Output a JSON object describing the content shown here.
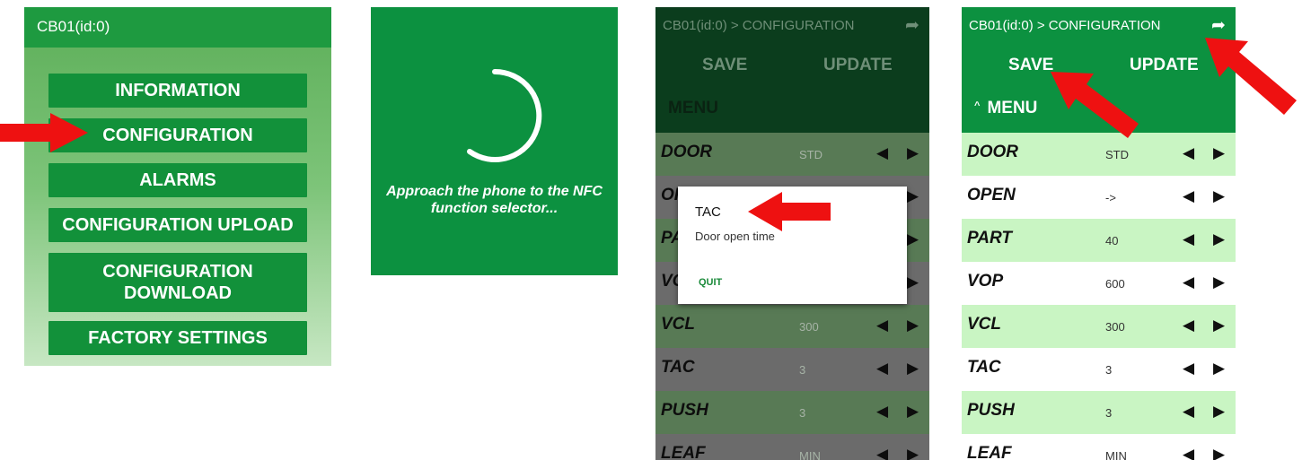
{
  "menu_screen": {
    "title": "CB01(id:0)",
    "buttons": [
      "INFORMATION",
      "CONFIGURATION",
      "ALARMS",
      "CONFIGURATION UPLOAD",
      "CONFIGURATION\nDOWNLOAD",
      "FACTORY SETTINGS"
    ]
  },
  "loading_screen": {
    "message": "Approach the phone to the NFC function selector..."
  },
  "config_screen": {
    "breadcrumb": "CB01(id:0) > CONFIGURATION",
    "share_icon": "share-icon",
    "save_label": "SAVE",
    "update_label": "UPDATE",
    "menu_label": "MENU",
    "left_arrow": "◀",
    "right_arrow": "▶",
    "rows": [
      {
        "name": "DOOR",
        "value": "STD"
      },
      {
        "name": "OPEN",
        "value": "->"
      },
      {
        "name": "PART",
        "value": "40"
      },
      {
        "name": "VOP",
        "value": "600"
      },
      {
        "name": "VCL",
        "value": "300"
      },
      {
        "name": "TAC",
        "value": "3"
      },
      {
        "name": "PUSH",
        "value": "3"
      },
      {
        "name": "LEAF",
        "value": "MIN"
      }
    ]
  },
  "dialog": {
    "title": "TAC",
    "description": "Door open time",
    "quit_label": "QUIT"
  },
  "colors": {
    "primary_green": "#0c9140",
    "row_light_green": "#c9f5c3",
    "annotation_arrow": "#ee1111"
  }
}
